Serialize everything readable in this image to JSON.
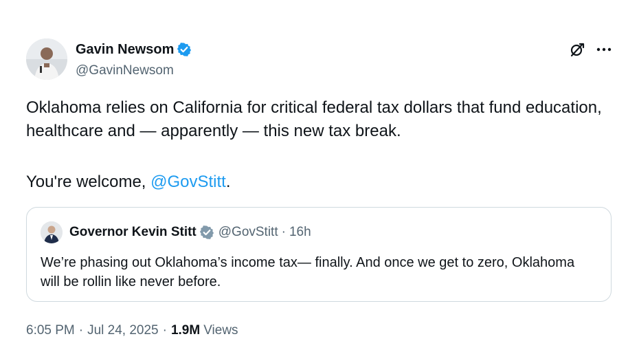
{
  "author": {
    "name": "Gavin Newsom",
    "handle": "@GavinNewsom"
  },
  "tweet": {
    "paragraph1": "Oklahoma relies on California for critical federal tax dollars that fund education, healthcare and — apparently — this new tax break.",
    "paragraph2_prefix": "You're welcome, ",
    "paragraph2_mention": "@GovStitt",
    "paragraph2_suffix": "."
  },
  "quoted_tweet": {
    "name": "Governor Kevin Stitt",
    "handle": "@GovStitt",
    "separator": "·",
    "age": "16h",
    "text": "We’re phasing out Oklahoma’s income tax— finally. And once we get to zero, Oklahoma will be rollin like never before."
  },
  "footer": {
    "time": "6:05 PM",
    "separator": "·",
    "date": "Jul 24, 2025",
    "views_count": "1.9M",
    "views_label": "Views"
  },
  "icons": {
    "verified": "verified-badge-icon",
    "verified_gray": "verified-gray-badge-icon",
    "grok": "grok-icon",
    "more": "more-horizontal-icon"
  },
  "colors": {
    "text": "#0f1419",
    "secondary": "#536471",
    "link": "#1d9bf0",
    "verified_blue": "#1d9bf0",
    "verified_gray": "#829aab",
    "border": "#cfd9de"
  }
}
